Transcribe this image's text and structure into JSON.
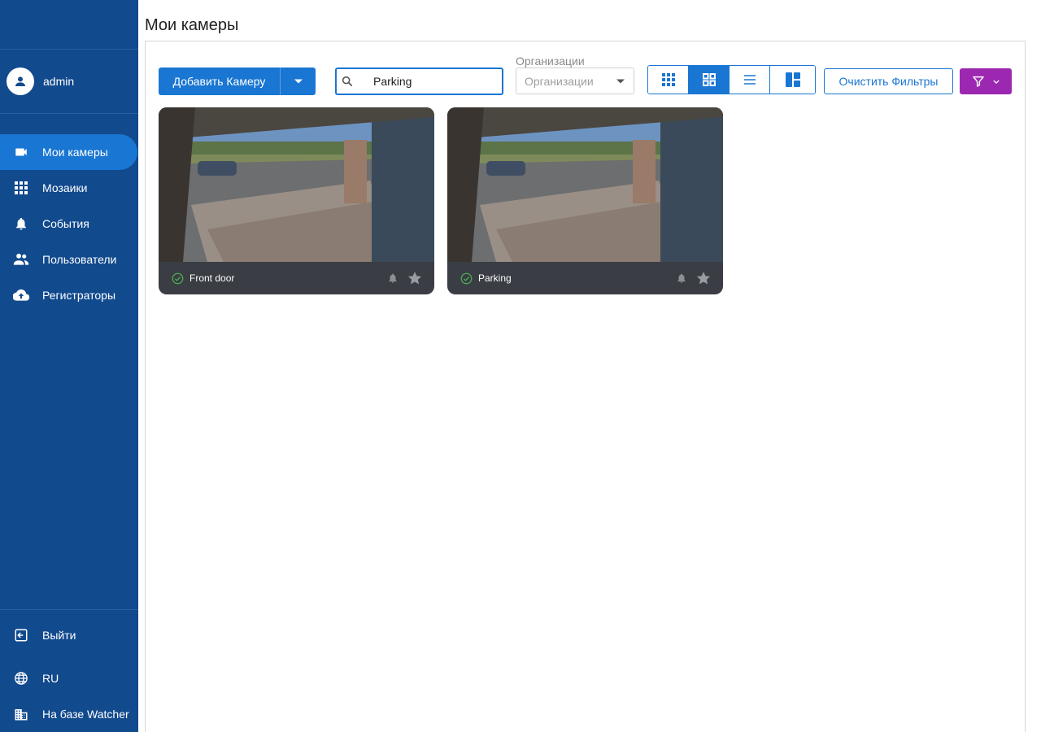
{
  "page": {
    "title": "Мои камеры"
  },
  "sidebar": {
    "user": {
      "name": "admin"
    },
    "nav": [
      {
        "label": "Мои камеры",
        "icon": "videocam-icon",
        "active": true
      },
      {
        "label": "Мозаики",
        "icon": "grid-icon",
        "active": false
      },
      {
        "label": "События",
        "icon": "bell-icon",
        "active": false
      },
      {
        "label": "Пользователи",
        "icon": "people-icon",
        "active": false
      },
      {
        "label": "Регистраторы",
        "icon": "cloud-upload-icon",
        "active": false
      }
    ],
    "bottom": {
      "logout": "Выйти",
      "language": "RU",
      "powered_by": "На базе Watcher"
    }
  },
  "toolbar": {
    "add_camera": "Добавить Камеру",
    "search": {
      "value": "Parking",
      "placeholder": ""
    },
    "organizations": {
      "label": "Организации",
      "placeholder": "Организации"
    },
    "view_modes": [
      "grid-small-icon",
      "grid-large-icon",
      "list-icon",
      "dashboard-icon"
    ],
    "active_view": "grid-large-icon",
    "clear_filters": "Очистить Фильтры"
  },
  "cameras": [
    {
      "name": "Front door",
      "status": "online"
    },
    {
      "name": "Parking",
      "status": "online"
    }
  ],
  "colors": {
    "sidebar": "#124a8e",
    "primary": "#1976d2",
    "filter": "#9c27b0",
    "card_footer": "#3a3d44",
    "online": "#4caf50"
  }
}
